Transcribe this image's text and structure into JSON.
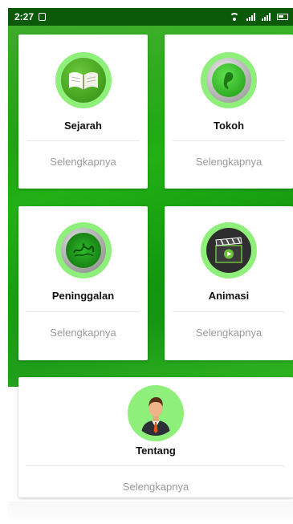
{
  "status_bar": {
    "time": "2:27"
  },
  "cards": {
    "sejarah": {
      "title": "Sejarah",
      "more": "Selengkapnya"
    },
    "tokoh": {
      "title": "Tokoh",
      "more": "Selengkapnya"
    },
    "peninggalan": {
      "title": "Peninggalan",
      "more": "Selengkapnya"
    },
    "animasi": {
      "title": "Animasi",
      "more": "Selengkapnya"
    },
    "tentang": {
      "title": "Tentang",
      "more": "Selengkapnya"
    }
  },
  "colors": {
    "primary_green": "#1a9e12",
    "icon_ring": "#8ef07a",
    "status_bar": "#0a5a0a"
  },
  "icons": {
    "sejarah": "open-book-icon",
    "tokoh": "figure-button-icon",
    "peninggalan": "ornament-medallion-icon",
    "animasi": "clapperboard-play-icon",
    "tentang": "person-in-suit-icon"
  }
}
